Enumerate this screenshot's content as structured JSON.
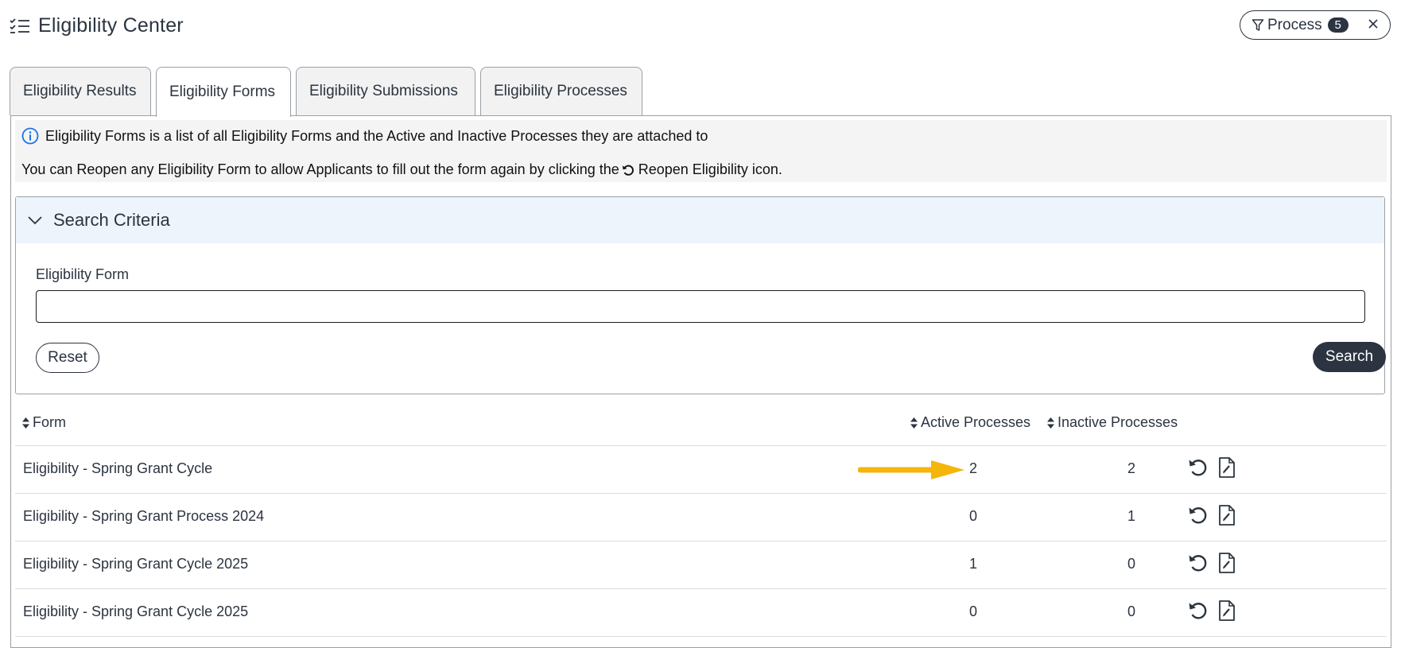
{
  "header": {
    "title": "Eligibility Center",
    "filter": {
      "label": "Process",
      "count": "5"
    }
  },
  "tabs": [
    {
      "label": "Eligibility Results",
      "active": false
    },
    {
      "label": "Eligibility Forms",
      "active": true
    },
    {
      "label": "Eligibility Submissions",
      "active": false
    },
    {
      "label": "Eligibility Processes",
      "active": false
    }
  ],
  "info": {
    "line1": "Eligibility Forms is a list of all Eligibility Forms and the Active and Inactive Processes they are attached to",
    "line2_before": "You can Reopen any Eligibility Form to allow Applicants to fill out the form again by clicking the",
    "line2_after": "Reopen Eligibility icon."
  },
  "criteria": {
    "title": "Search Criteria",
    "field_label": "Eligibility Form",
    "field_value": "",
    "reset_label": "Reset",
    "search_label": "Search"
  },
  "table": {
    "columns": {
      "form": "Form",
      "active": "Active Processes",
      "inactive": "Inactive Processes"
    },
    "rows": [
      {
        "form": "Eligibility - Spring Grant Cycle",
        "active": "2",
        "inactive": "2"
      },
      {
        "form": "Eligibility - Spring Grant Process 2024",
        "active": "0",
        "inactive": "1"
      },
      {
        "form": "Eligibility - Spring Grant Cycle 2025",
        "active": "1",
        "inactive": "0"
      },
      {
        "form": "Eligibility - Spring Grant Cycle 2025",
        "active": "0",
        "inactive": "0"
      }
    ]
  },
  "colors": {
    "primary": "#2b3440",
    "info_bg": "#f4f4f4",
    "criteria_head_bg": "#eef4fb",
    "info_icon": "#1a73e8",
    "annotation_arrow": "#f5b50a"
  },
  "icons": {
    "title": "checklist-icon",
    "filter": "funnel-icon",
    "close": "close-icon",
    "info": "info-circle-icon",
    "collapse": "chevron-down-icon",
    "sort": "sort-icon",
    "reopen": "reopen-icon",
    "edit": "edit-document-icon"
  }
}
